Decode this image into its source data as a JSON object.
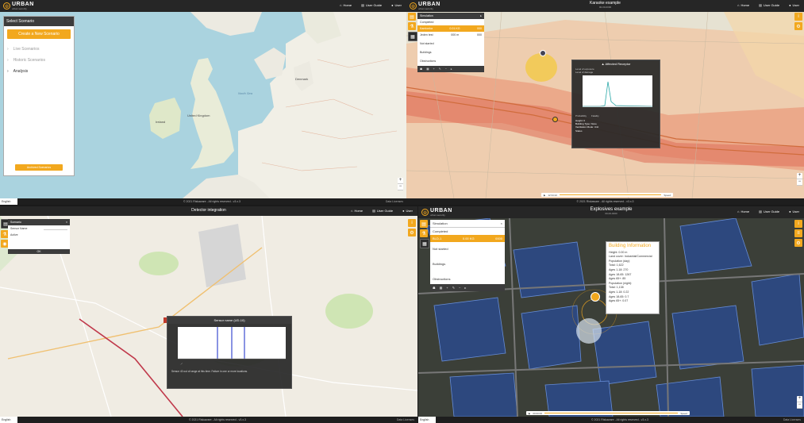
{
  "brand": {
    "name": "URBAN",
    "subtitle": "urban security"
  },
  "panels": {
    "tl": {
      "nav": [
        "Home",
        "User Guide",
        "User"
      ],
      "scenario": {
        "header": "Select Scenario",
        "create_button": "Create a New Scenario",
        "items": [
          {
            "label": "Live Scenarios",
            "active": false
          },
          {
            "label": "Historic Scenarios",
            "active": false
          },
          {
            "label": "Analysis",
            "active": true
          }
        ],
        "archived_button": "Archived Scenarios"
      },
      "map_labels": {
        "uk": "United Kingdom",
        "ireland": "Ireland",
        "denmark": "Denmark",
        "north_sea": "North Sea"
      },
      "footer": "© 2021 Riskaware - All rights reserved - v3.x.3",
      "version": "Data Licenses",
      "language": "English"
    },
    "tr": {
      "title": "Karaoke example",
      "subtitle": "00-00-0000",
      "nav": [
        "Home",
        "User Guide",
        "User"
      ],
      "simulation": {
        "header": "Simulation",
        "status": "Completed",
        "rows": [
          {
            "label": "Kamionka",
            "v1": "0.01 KG",
            "v2": "000",
            "sel": true
          },
          {
            "label": "Jeden test",
            "v1": "000 m",
            "v2": "000",
            "sel": false
          }
        ],
        "extras": [
          "Not started",
          "Buildings",
          "Obstructions"
        ]
      },
      "popup": {
        "title": "▲ Affected Receptor",
        "fields": [
          "Level of exposure",
          "Level of damage"
        ],
        "legend": [
          "Probability",
          "Fatality"
        ],
        "info": [
          "Height: 0",
          "Building Type: None",
          "Ventilation Mode: Unit",
          "Status"
        ]
      },
      "playbar": {
        "time": "12:34:22",
        "speed": "Speed"
      },
      "footer": "© 2021 Riskaware - All rights reserved - v3.x.3"
    },
    "bl": {
      "title": "Detector integration",
      "nav": [
        "Home",
        "User Guide",
        "User"
      ],
      "detector_panel": {
        "header": "Scenario",
        "rows": [
          "Sensor Name",
          "Active"
        ],
        "button": "OK"
      },
      "chart": {
        "title": "Sensor name (UD-10)",
        "note": "Sensor 40 out of range at this time. Failure in one or more locations."
      },
      "footer": "© 2021 Riskaware - All rights reserved - v3.x.3",
      "version": "Data Licenses",
      "language": "English"
    },
    "br": {
      "title": "Explosives example",
      "subtitle": "00-00-0000",
      "nav": [
        "Home",
        "User Guide",
        "User"
      ],
      "simulation": {
        "header": "Simulation",
        "status": "Completed",
        "rows": [
          {
            "label": "BLD-1",
            "v1": "0.00 KG",
            "v2": "0000",
            "sel": true
          }
        ],
        "extras": [
          "Not started",
          "Buildings",
          "Obstructions"
        ]
      },
      "building_info": {
        "title": "Building Information",
        "lines": [
          "Height: 0.00 m",
          "Land cover: Industrial/Commercial",
          "Population (day):",
          "Total: 1,622",
          "Ages 1-18: 270",
          "Ages 18-65: 1267",
          "Ages 65+: 85",
          "Population (night):",
          "Total: 1,138",
          "Ages 1-18: 0.22",
          "Ages 18-65: 0.7",
          "Ages 65+: 0.07"
        ]
      },
      "playbar": {
        "time": "00:00:00",
        "speed": "Speed"
      },
      "footer": "© 2021 Riskaware - All rights reserved - v3.x.3",
      "version": "Data Licenses",
      "language": "English"
    }
  },
  "colors": {
    "accent": "#f2a81e",
    "topbar": "#262626",
    "panel_head": "#3c3c3c"
  }
}
